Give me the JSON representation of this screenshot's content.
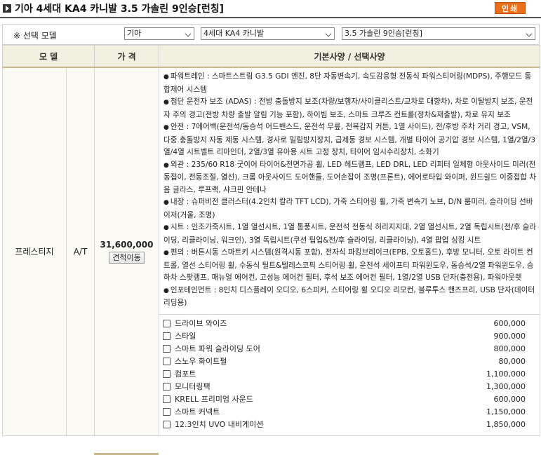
{
  "title": "기아 4세대 KA4 카니발 3.5 가솔린 9인승[런칭]",
  "print_label": "인쇄",
  "selector": {
    "label": "※ 선택 모델",
    "brand": "기아",
    "model": "4세대 KA4 카니발",
    "trim": "3.5 가솔린 9인승[런칭]"
  },
  "table": {
    "headers": {
      "model": "모 델",
      "price": "가 격",
      "specs": "기본사양 / 선택사양"
    },
    "row": {
      "trim_name": "프레스티지",
      "transmission": "A/T",
      "price": "31,600,000",
      "quote_button": "견적이동"
    },
    "specs": [
      "파워트레인 : 스마트스트림 G3.5 GDI 엔진, 8단 자동변속기, 속도감응형 전동식 파워스티어링(MDPS), 주행모드 통합제어 시스템",
      "첨단 운전자 보조 (ADAS) : 전방 충돌방지 보조(차량/보행자/사이클리스트/교차로 대향차), 차로 이탈방지 보조, 운전자 주의 경고(전방 차량 출발 알림 기능 포함), 하이빔 보조, 스마트 크루즈 컨트롤(정차&재출발), 차로 유지 보조",
      "안전 : 7에어백(운전석/동승석 어드밴스드, 운전석 무릎, 전복감지 커튼, 1열 사이드), 전/후방 주차 거리 경고, VSM, 다중 충돌방지 자동 제동 시스템, 경사로 밀림방지장치, 급제동 경보 시스템, 개별 타이어 공기압 경보 시스템, 1열/2열/3열/4열 시트벨트 리마인더, 2열/3열 유아용 시트 고정 장치, 타이어 임시수리장치, 소화기",
      "외관 : 235/60 R18 굿이어 타이어&전면가공 휠, LED 헤드램프, LED DRL, LED 리피터 일체형 아웃사이드 미러(전동접이, 전동조절, 열선), 크롬 아웃사이드 도어핸들, 도어손잡이 조명(프론트), 에어로타입 와이퍼, 윈드쉴드 이중접합 차음 글라스, 루프랙, 샤크핀 안테나",
      "내장 : 슈퍼비전 클러스터(4.2인치 칼라 TFT LCD), 가죽 스티어링 휠, 가죽 변속기 노브, D/N 룸미러, 슬라이딩 선바이저(거울, 조명)",
      "시트 : 인조가죽시트, 1열 열선시트, 1열 통풍시트, 운전석 전동식 허리지지대, 2열 열선시트, 2열 독립시트(전/후 슬라이딩, 리클라이닝, 워크인), 3열 독립시트(쿠션 팁업&전/후 슬라이딩, 리클라이닝), 4열 팝업 싱킹 시트",
      "편의 : 버튼시동 스마트키 시스템(원격시동 포함), 전자식 파킹브레이크(EPB, 오토홀드), 후방 모니터, 오토 라이트 컨트롤, 열선 스티어링 휠, 수동식 틸트&텔레스코픽 스티어링 휠, 운전석 세이프티 파워윈도우, 동승석/2열 파워윈도우, 승하차 스팟램프, 매뉴얼 에어컨, 고성능 에어컨 필터, 후석 보조 에어컨 필터, 1열/2열 USB 단자(충전용), 파워아웃렛",
      "인포테인먼트 : 8인치 디스플레이 오디오, 6스피커, 스티어링 휠 오디오 리모컨, 블루투스 핸즈프리, USB 단자(데이터리딩용)"
    ],
    "options": [
      {
        "name": "드라이브 와이즈",
        "price": "600,000"
      },
      {
        "name": "스타일",
        "price": "900,000"
      },
      {
        "name": "스마트 파워 슬라이딩 도어",
        "price": "800,000"
      },
      {
        "name": "스노우 화이트펄",
        "price": "80,000"
      },
      {
        "name": "컴포트",
        "price": "1,100,000"
      },
      {
        "name": "모니터링팩",
        "price": "1,300,000"
      },
      {
        "name": "KRELL 프리미엄 사운드",
        "price": "600,000"
      },
      {
        "name": "스마트 커넥트",
        "price": "1,150,000"
      },
      {
        "name": "12.3인치 UVO 내비게이션",
        "price": "1,850,000"
      }
    ]
  },
  "colors": {
    "print_button": "#e96f1a",
    "header_bg": "#f2f1e1",
    "header_border": "#c9b98a"
  }
}
